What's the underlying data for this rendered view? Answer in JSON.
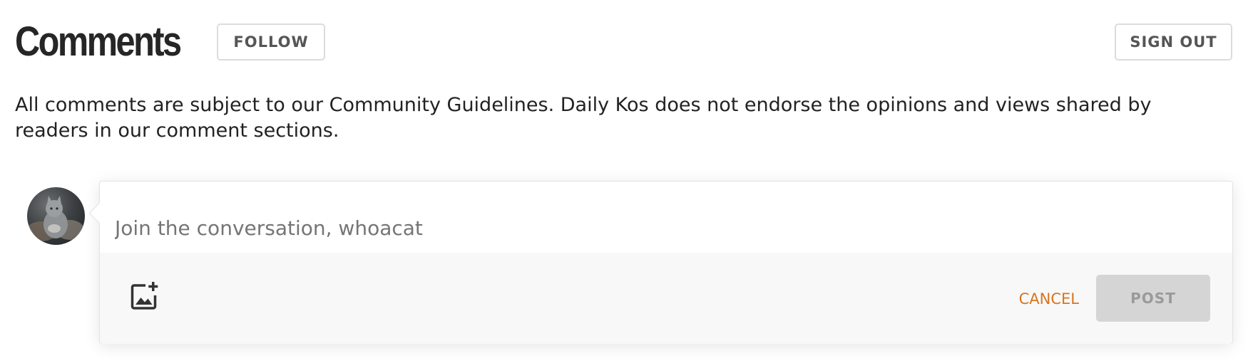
{
  "header": {
    "title": "Comments",
    "follow_label": "FOLLOW",
    "signout_label": "SIGN OUT"
  },
  "guidelines_text": "All comments are subject to our Community Guidelines. Daily Kos does not endorse the opinions and views shared by readers in our comment sections.",
  "composer": {
    "placeholder": "Join the conversation, whoacat",
    "value": "",
    "image_icon": "add-image-icon",
    "cancel_label": "CANCEL",
    "post_label": "POST"
  },
  "avatar_icon": "user-avatar-cat",
  "colors": {
    "cancel": "#d9741b",
    "post_disabled_bg": "#d5d5d5",
    "post_disabled_text": "#9a9a9a",
    "outline_border": "#dcdcdc"
  }
}
